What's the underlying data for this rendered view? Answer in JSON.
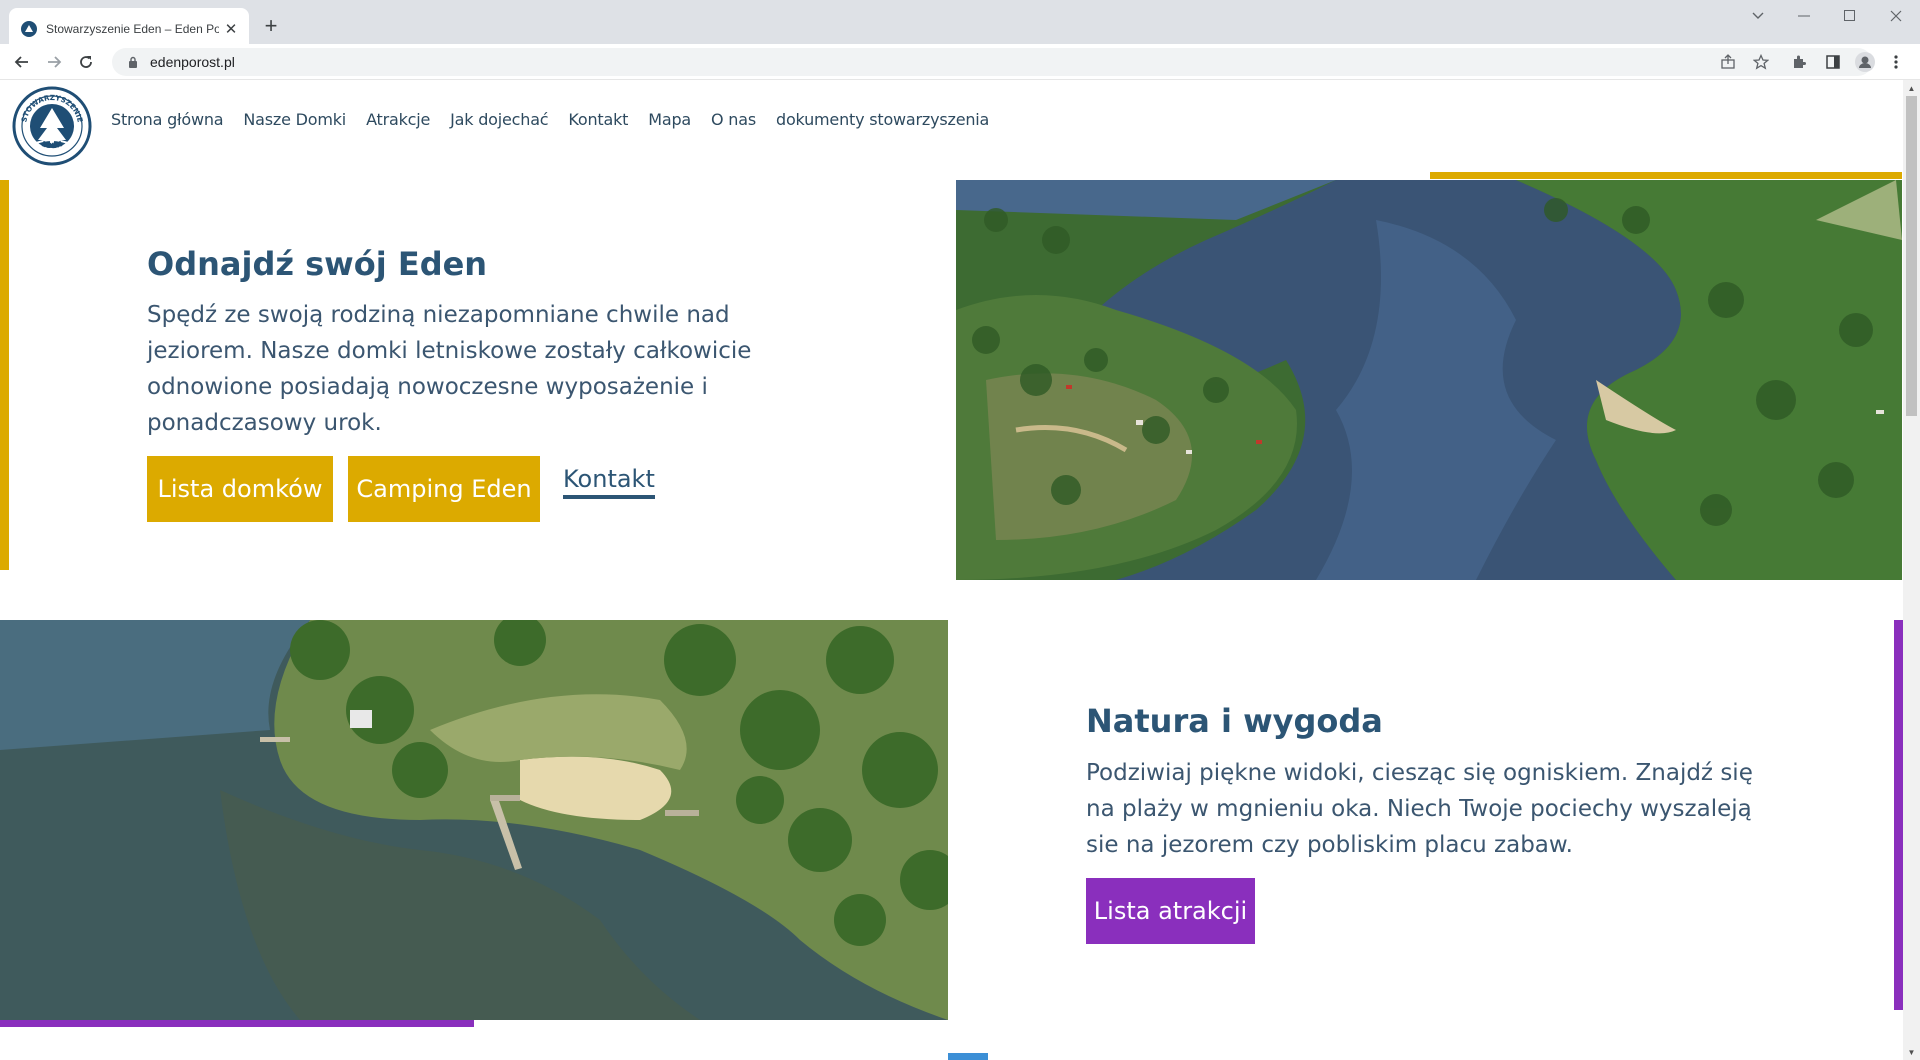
{
  "browser": {
    "tab_title": "Stowarzyszenie Eden – Eden Porost",
    "url": "edenporost.pl"
  },
  "site": {
    "logo_text_top": "STOWARZYSZENIE",
    "logo_text_bottom": "EDEN",
    "nav": [
      "Strona główna",
      "Nasze Domki",
      "Atrakcje",
      "Jak dojechać",
      "Kontakt",
      "Mapa",
      "O nas",
      "dokumenty stowarzyszenia"
    ]
  },
  "section1": {
    "heading": "Odnajdź swój Eden",
    "text": "Spędź ze swoją rodziną niezapomniane chwile nad jeziorem. Nasze domki letniskowe zostały całkowicie odnowione posiadają nowoczesne wyposażenie i ponadczasowy urok.",
    "btn_cottages": "Lista domków",
    "btn_camping": "Camping Eden",
    "link_contact": "Kontakt"
  },
  "section2": {
    "heading": "Natura i wygoda",
    "text": "Podziwiaj piękne widoki, ciesząc się ogniskiem. Znajdź się na plaży w mgnieniu oka. Niech Twoje pociechy wyszaleją sie na jezorem czy pobliskim placu zabaw.",
    "btn_attractions": "Lista atrakcji"
  },
  "colors": {
    "gold": "#dcaa00",
    "purple": "#8a2fbd",
    "navy": "#2c5575"
  },
  "icons": [
    "back-icon",
    "forward-icon",
    "reload-icon",
    "lock-icon",
    "share-icon",
    "star-icon",
    "extensions-icon",
    "sidepanel-icon",
    "profile-icon",
    "menu-icon"
  ]
}
